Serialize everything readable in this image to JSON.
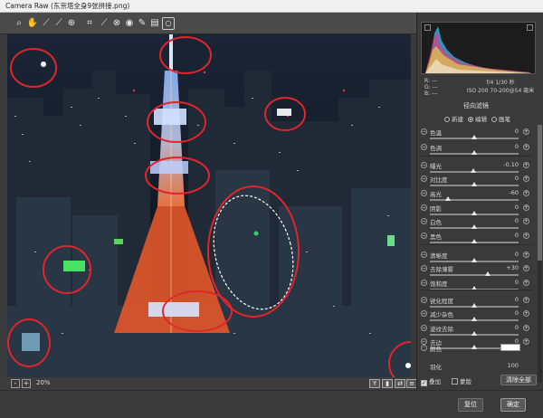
{
  "window": {
    "title": "Camera Raw (东京塔全身9张拼接.png)"
  },
  "toolbar": {
    "tools": [
      "zoom-tool-icon",
      "hand-tool-icon",
      "white-balance-icon",
      "color-sampler-icon",
      "target-adjust-icon",
      "crop-tool-icon",
      "straighten-icon",
      "spot-removal-icon",
      "red-eye-icon",
      "adjustment-brush-icon",
      "graduated-filter-icon",
      "radial-filter-icon"
    ]
  },
  "footer": {
    "zoom_value": "20%",
    "zoom_minus": "-",
    "zoom_plus": "+",
    "view_y": "Y"
  },
  "bottom": {
    "reset_label": "复位",
    "ok_label": "确定"
  },
  "panel": {
    "cam_left": [
      "R: ---",
      "G: ---",
      "B: ---"
    ],
    "cam_right": [
      "f/4  1/30 秒",
      "ISO 200  70-200@54 毫米"
    ],
    "title": "径向滤镜",
    "modes": [
      {
        "label": "新建",
        "selected": false
      },
      {
        "label": "编辑",
        "selected": true
      },
      {
        "label": "画笔",
        "selected": false
      }
    ],
    "sliders": [
      {
        "label": "色温",
        "value": "0",
        "pos": 0.5
      },
      {
        "label": "色调",
        "value": "0",
        "pos": 0.5
      },
      {
        "label": "曝光",
        "value": "-0.10",
        "pos": 0.49
      },
      {
        "label": "对比度",
        "value": "0",
        "pos": 0.5
      },
      {
        "label": "高光",
        "value": "-60",
        "pos": 0.2
      },
      {
        "label": "阴影",
        "value": "0",
        "pos": 0.5
      },
      {
        "label": "白色",
        "value": "0",
        "pos": 0.5
      },
      {
        "label": "黑色",
        "value": "0",
        "pos": 0.5
      },
      {
        "label": "清晰度",
        "value": "0",
        "pos": 0.5
      },
      {
        "label": "去除薄雾",
        "value": "+30",
        "pos": 0.65
      },
      {
        "label": "饱和度",
        "value": "0",
        "pos": 0.5
      },
      {
        "label": "锐化程度",
        "value": "0",
        "pos": 0.5
      },
      {
        "label": "减少杂色",
        "value": "0",
        "pos": 0.5
      },
      {
        "label": "波纹去除",
        "value": "0",
        "pos": 0.5
      },
      {
        "label": "去边",
        "value": "0",
        "pos": 0.5
      }
    ],
    "color_label": "颜色",
    "feather_label": "羽化",
    "feather_value": "100",
    "overlay_label": "叠加",
    "mask_label": "蒙版",
    "clear_all_label": "清除全部"
  }
}
